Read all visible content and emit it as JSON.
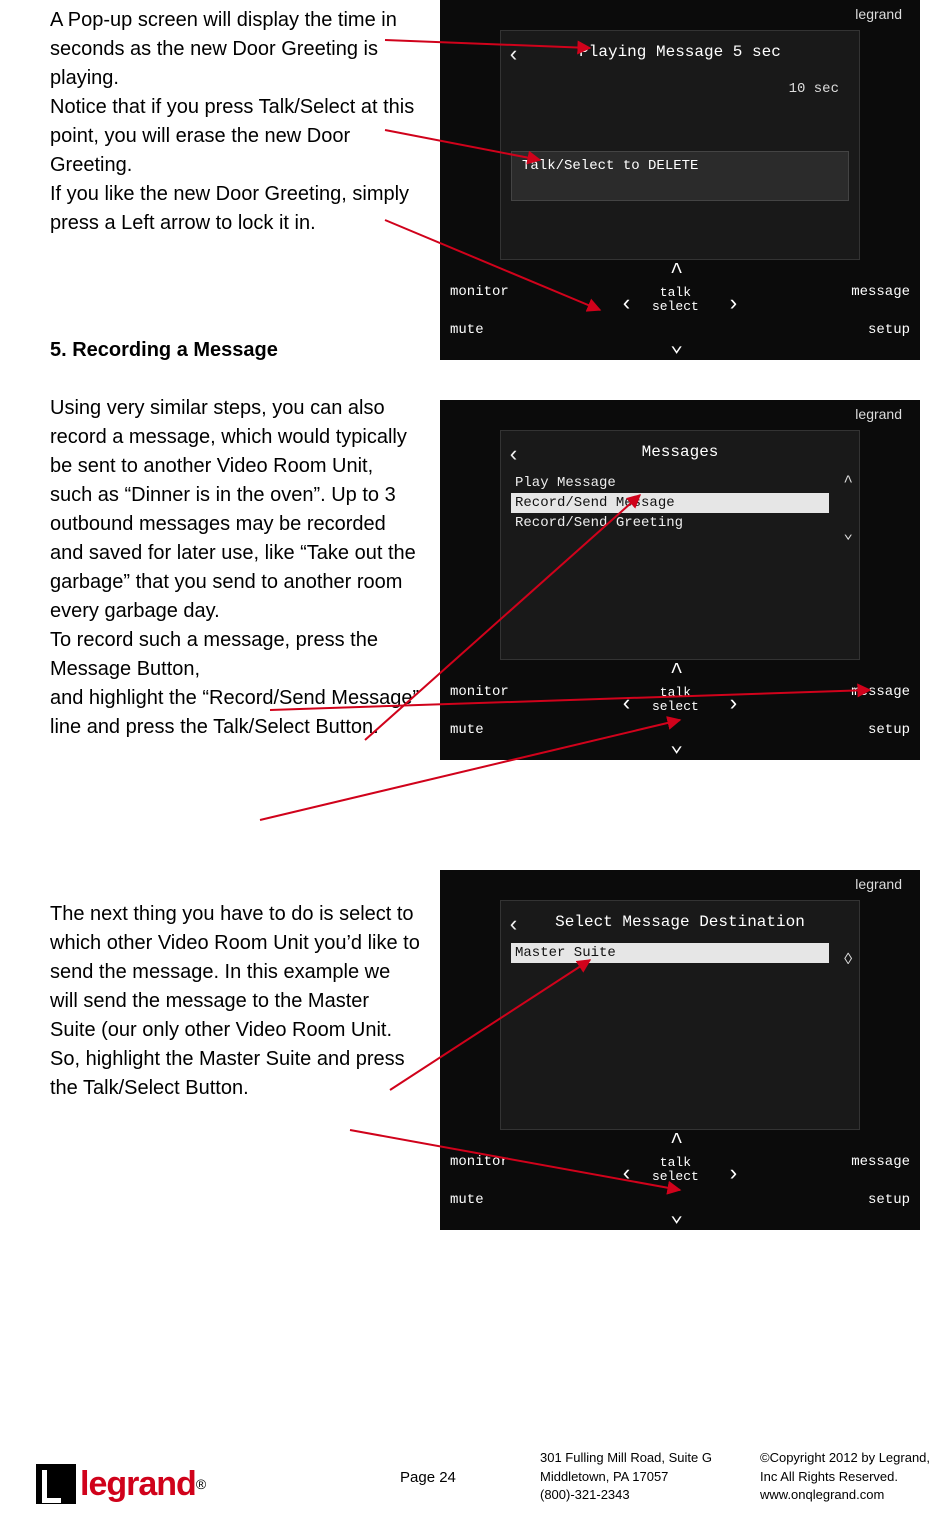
{
  "text": {
    "p1": "A Pop-up screen will display the time in seconds as the new Door Greeting is playing.",
    "p2": "Notice that if you press Talk/Select at this point, you will erase the new Door Greeting.",
    "p3": "If you like the new Door Greeting, simply press a Left arrow to lock it in.",
    "h5": "5. Recording a Message",
    "p4": "Using very similar steps, you can also record a message, which would typically be sent to another Video Room Unit, such as “Dinner is in the oven”. Up to 3 outbound messages may be recorded and saved for later use, like “Take out the garbage” that you send to another room every garbage day.",
    "p5": "To record such a message, press the Message Button,",
    "p6": "and highlight the “Record/Send Message” line and press the Talk/Select Button.",
    "p7": "The next thing you have to do is select to which other Video Room Unit you’d like to send the message. In this example we will send the message to the Master Suite (our only other Video Room Unit.",
    "p8": "So, highlight the Master Suite and press the Talk/Select Button."
  },
  "device": {
    "brand": "legrand",
    "corners": {
      "tl": "monitor",
      "bl": "mute",
      "tr": "message",
      "br": "setup"
    },
    "dpad": {
      "center1": "talk",
      "center2": "select"
    }
  },
  "screen1": {
    "title": "Playing Message 5 sec",
    "sub": "10 sec",
    "banner": "Talk/Select to DELETE"
  },
  "screen2": {
    "title": "Messages",
    "rows": [
      "Play Message",
      "Record/Send Message",
      "Record/Send Greeting"
    ]
  },
  "screen3": {
    "title": "Select Message Destination",
    "rows": [
      "Master Suite"
    ]
  },
  "footer": {
    "logo": "legrand",
    "reg": "®",
    "pagenum": "Page 24",
    "addr1": "301 Fulling Mill Road, Suite G",
    "addr2": "Middletown, PA   17057",
    "addr3": "(800)-321-2343",
    "copy1": "©Copyright 2012 by Legrand,",
    "copy2": "Inc All Rights Reserved.",
    "copy3": "www.onqlegrand.com"
  }
}
